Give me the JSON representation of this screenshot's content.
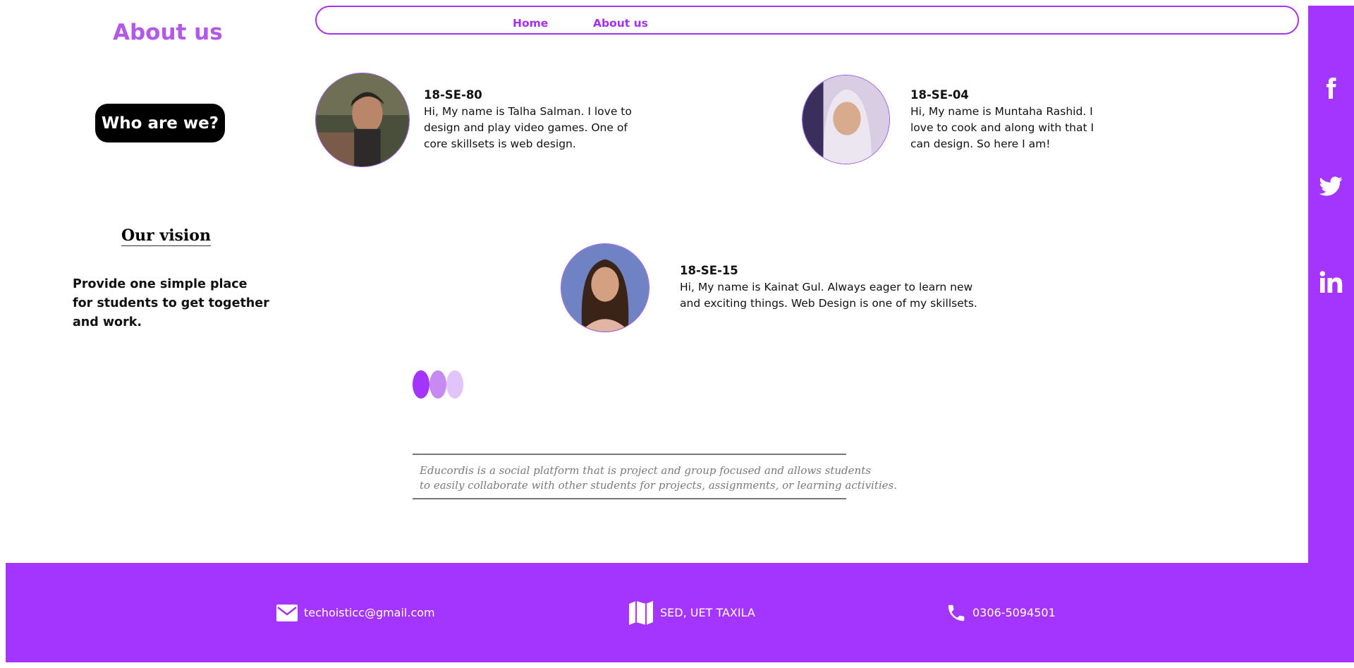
{
  "page": {
    "title": "About us"
  },
  "left": {
    "cta_label": "Who are we?",
    "vision_title": "Our vision",
    "vision_text": "Provide one simple place for students to get together and work."
  },
  "nav": {
    "items": [
      {
        "label": "Home"
      },
      {
        "label": "About us"
      }
    ]
  },
  "members": [
    {
      "id": "18-SE-80",
      "bio": "Hi, My name is Talha Salman. I love to design and play video games. One of core skillsets is web design."
    },
    {
      "id": "18-SE-04",
      "bio": "Hi, My name is Muntaha Rashid. I love to cook and along with that I can design. So here I am!"
    },
    {
      "id": "18-SE-15",
      "bio": "Hi, My name is Kainat Gul. Always eager to learn new and exciting things. Web Design is one of my skillsets."
    }
  ],
  "dots": [
    "#a435ff",
    "#c78af0",
    "#e2c4fa"
  ],
  "quote": {
    "line1": "Educordis is a social platform that is project and group focused and allows students",
    "line2": "to easily collaborate with other students for projects, assignments, or learning activities."
  },
  "social": [
    "facebook-icon",
    "twitter-icon",
    "linkedin-icon"
  ],
  "footer": {
    "email": "techoisticc@gmail.com",
    "location": "SED, UET TAXILA",
    "phone": "0306-5094501"
  },
  "colors": {
    "accent": "#a435ff",
    "title": "#b259e8",
    "nav": "#a431f1"
  }
}
